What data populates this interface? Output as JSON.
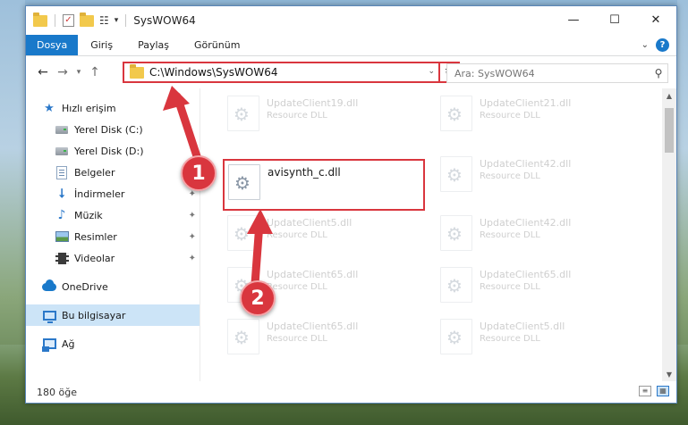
{
  "window": {
    "title": "SysWOW64"
  },
  "ribbon": {
    "tabs": [
      {
        "label": "Dosya",
        "active": true
      },
      {
        "label": "Giriş"
      },
      {
        "label": "Paylaş"
      },
      {
        "label": "Görünüm"
      }
    ]
  },
  "nav": {
    "address": "C:\\Windows\\SysWOW64",
    "search_placeholder": "Ara: SysWOW64"
  },
  "sidebar": {
    "items": [
      {
        "label": "Hızlı erişim",
        "icon": "star-icon"
      },
      {
        "label": "Yerel Disk (C:)",
        "icon": "disk-icon"
      },
      {
        "label": "Yerel Disk (D:)",
        "icon": "disk-icon"
      },
      {
        "label": "Belgeler",
        "icon": "document-icon"
      },
      {
        "label": "İndirmeler",
        "icon": "download-icon",
        "pinned": true
      },
      {
        "label": "Müzik",
        "icon": "music-icon",
        "pinned": true
      },
      {
        "label": "Resimler",
        "icon": "pictures-icon",
        "pinned": true
      },
      {
        "label": "Videolar",
        "icon": "video-icon",
        "pinned": true
      },
      {
        "label": "OneDrive",
        "icon": "onedrive-icon"
      },
      {
        "label": "Bu bilgisayar",
        "icon": "this-pc-icon",
        "selected": true
      },
      {
        "label": "Ağ",
        "icon": "network-icon"
      }
    ]
  },
  "files": {
    "highlighted": {
      "name": "avisynth_c.dll"
    },
    "left_column": [
      {
        "name": "UpdateClient19.dll",
        "type": "Resource DLL"
      },
      {
        "name": "UpdateClient5.dll",
        "type": "Resource DLL"
      },
      {
        "name": "UpdateClient65.dll",
        "type": "Resource DLL"
      },
      {
        "name": "UpdateClient65.dll",
        "type": "Resource DLL"
      }
    ],
    "right_column": [
      {
        "name": "UpdateClient21.dll",
        "type": "Resource DLL"
      },
      {
        "name": "UpdateClient42.dll",
        "type": "Resource DLL"
      },
      {
        "name": "UpdateClient42.dll",
        "type": "Resource DLL"
      },
      {
        "name": "UpdateClient65.dll",
        "type": "Resource DLL"
      },
      {
        "name": "UpdateClient5.dll",
        "type": "Resource DLL"
      }
    ]
  },
  "status": {
    "item_count": "180 öğe"
  },
  "callouts": {
    "one": "1",
    "two": "2"
  },
  "colors": {
    "accent": "#1979ca",
    "annotation_red": "#d9363e",
    "selected_bg": "#cce4f7"
  }
}
